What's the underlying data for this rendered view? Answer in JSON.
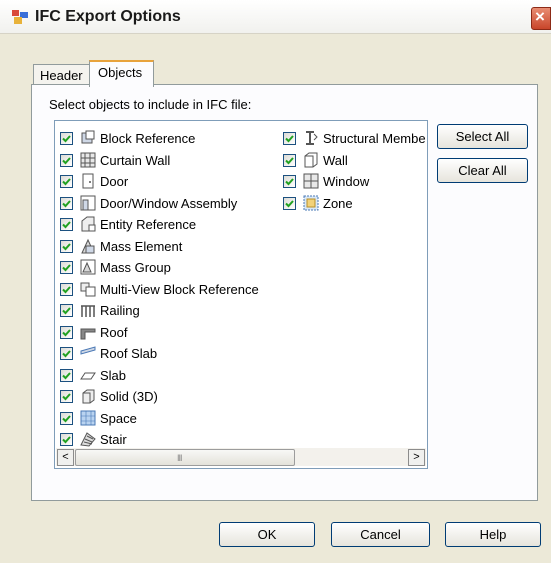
{
  "window": {
    "title": "IFC Export Options"
  },
  "tabs": [
    {
      "label": "Header",
      "selected": false
    },
    {
      "label": "Objects",
      "selected": true
    }
  ],
  "objects_page": {
    "instruction": "Select objects to include in IFC file:",
    "column1": [
      {
        "label": "Block Reference",
        "checked": true,
        "icon": "block-reference-icon"
      },
      {
        "label": "Curtain Wall",
        "checked": true,
        "icon": "curtain-wall-icon"
      },
      {
        "label": "Door",
        "checked": true,
        "icon": "door-icon"
      },
      {
        "label": "Door/Window Assembly",
        "checked": true,
        "icon": "door-window-assembly-icon"
      },
      {
        "label": "Entity Reference",
        "checked": true,
        "icon": "entity-reference-icon"
      },
      {
        "label": "Mass Element",
        "checked": true,
        "icon": "mass-element-icon"
      },
      {
        "label": "Mass Group",
        "checked": true,
        "icon": "mass-group-icon"
      },
      {
        "label": "Multi-View Block Reference",
        "checked": true,
        "icon": "multi-view-block-icon"
      },
      {
        "label": "Railing",
        "checked": true,
        "icon": "railing-icon"
      },
      {
        "label": "Roof",
        "checked": true,
        "icon": "roof-icon"
      },
      {
        "label": "Roof Slab",
        "checked": true,
        "icon": "roof-slab-icon"
      },
      {
        "label": "Slab",
        "checked": true,
        "icon": "slab-icon"
      },
      {
        "label": "Solid (3D)",
        "checked": true,
        "icon": "solid-3d-icon"
      },
      {
        "label": "Space",
        "checked": true,
        "icon": "space-icon"
      },
      {
        "label": "Stair",
        "checked": true,
        "icon": "stair-icon"
      }
    ],
    "column2": [
      {
        "label": "Structural Membe",
        "checked": true,
        "icon": "structural-member-icon"
      },
      {
        "label": "Wall",
        "checked": true,
        "icon": "wall-icon"
      },
      {
        "label": "Window",
        "checked": true,
        "icon": "window-icon"
      },
      {
        "label": "Zone",
        "checked": true,
        "icon": "zone-icon"
      }
    ],
    "select_all_label": "Select All",
    "clear_all_label": "Clear All",
    "scroll_left": "<",
    "scroll_right": ">",
    "scroll_grip": "III"
  },
  "footer": {
    "ok_label": "OK",
    "cancel_label": "Cancel",
    "help_label": "Help"
  },
  "colors": {
    "checkmark": "#21a121",
    "active_tab_accent": "#e8a33c",
    "close_button": "#c8452a"
  }
}
